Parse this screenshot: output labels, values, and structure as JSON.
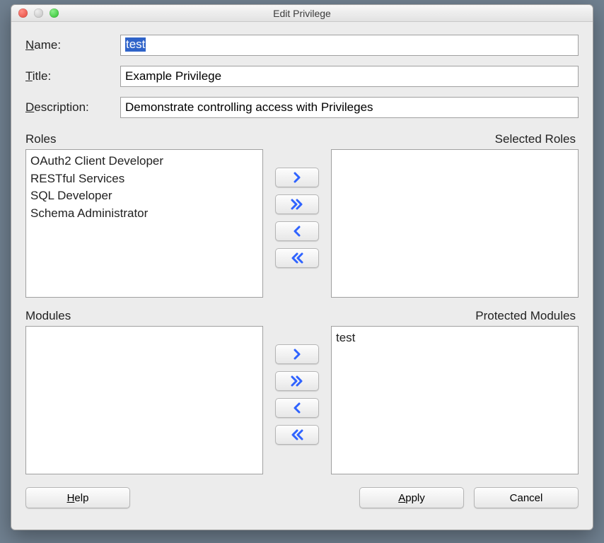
{
  "window": {
    "title": "Edit Privilege"
  },
  "form": {
    "name": {
      "label_pre": "N",
      "label_post": "ame:",
      "value": "test"
    },
    "title": {
      "label_pre": "T",
      "label_post": "itle:",
      "value": "Example Privilege"
    },
    "description": {
      "label_pre": "D",
      "label_post": "escription:",
      "value": "Demonstrate controlling access with Privileges"
    }
  },
  "roles": {
    "left_label": "Roles",
    "right_label": "Selected Roles",
    "available": [
      "OAuth2 Client Developer",
      "RESTful Services",
      "SQL Developer",
      "Schema Administrator"
    ],
    "selected": []
  },
  "modules": {
    "left_label": "Modules",
    "right_label": "Protected Modules",
    "available": [],
    "selected": [
      "test"
    ]
  },
  "buttons": {
    "help_pre": "H",
    "help_post": "elp",
    "apply_pre": "A",
    "apply_post": "pply",
    "cancel": "Cancel"
  }
}
